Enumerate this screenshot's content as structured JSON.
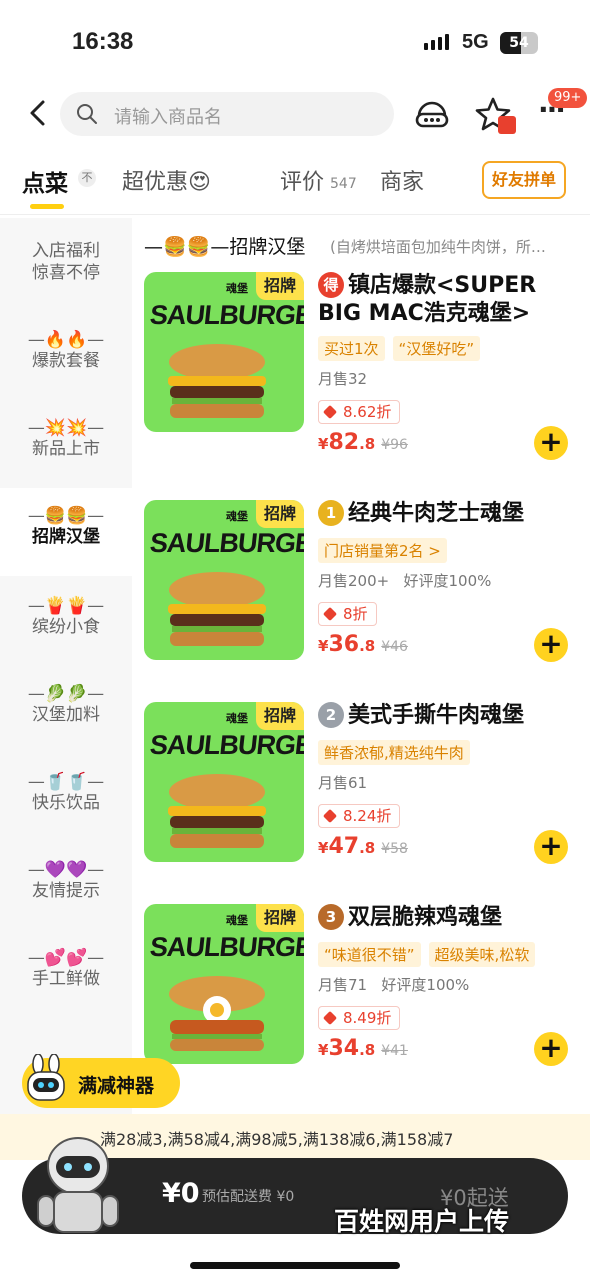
{
  "status_bar": {
    "time": "16:38",
    "network": "5G",
    "battery": "54",
    "battery_level": 0.54
  },
  "header": {
    "search_placeholder": "请输入商品名",
    "more_badge": "99+"
  },
  "tabs": {
    "order": "点菜",
    "order_badge": "不",
    "deals": "超优惠😍",
    "reviews": "评价",
    "reviews_count": "547",
    "merchant": "商家",
    "group_order": "好友拼单"
  },
  "sidebar": {
    "items": [
      {
        "emoji": "",
        "label": "入店福利\n惊喜不停"
      },
      {
        "emoji": "—🔥🔥—",
        "label": "爆款套餐"
      },
      {
        "emoji": "—💥💥—",
        "label": "新品上市"
      },
      {
        "emoji": "—🍔🍔—",
        "label": "招牌汉堡"
      },
      {
        "emoji": "—🍟🍟—",
        "label": "缤纷小食"
      },
      {
        "emoji": "—🥬🥬—",
        "label": "汉堡加料"
      },
      {
        "emoji": "—🥤🥤—",
        "label": "快乐饮品"
      },
      {
        "emoji": "—💜💜—",
        "label": "友情提示"
      },
      {
        "emoji": "—💕💕—",
        "label": "手工鲜做"
      }
    ]
  },
  "section": {
    "title": "—🍔🍔—招牌汉堡",
    "desc": "(自烤烘培面包加纯牛肉饼，所…"
  },
  "products": [
    {
      "brand": "SAULBURGER",
      "top_text": "魂堡",
      "tag": "招牌",
      "rank": "得",
      "name": "镇店爆款<SUPER BIG MAC浩克魂堡>",
      "chips": [
        "买过1次",
        "“汉堡好吃”"
      ],
      "sales": "月售32",
      "rating": "",
      "discount": "8.62折",
      "price_symbol": "¥",
      "price_main": "82",
      "price_dec": ".8",
      "old_price": "¥96"
    },
    {
      "brand": "SAULBURGER",
      "top_text": "魂堡",
      "tag": "招牌",
      "rank": "1",
      "name": "经典牛肉芝士魂堡",
      "chips": [
        "门店销量第2名 >"
      ],
      "sales": "月售200+",
      "rating": "好评度100%",
      "discount": "8折",
      "price_symbol": "¥",
      "price_main": "36",
      "price_dec": ".8",
      "old_price": "¥46"
    },
    {
      "brand": "SAULBURGER",
      "top_text": "魂堡",
      "tag": "招牌",
      "rank": "2",
      "name": "美式手撕牛肉魂堡",
      "chips": [
        "鲜香浓郁,精选纯牛肉"
      ],
      "sales": "月售61",
      "rating": "",
      "discount": "8.24折",
      "price_symbol": "¥",
      "price_main": "47",
      "price_dec": ".8",
      "old_price": "¥58"
    },
    {
      "brand": "SAULBURGER",
      "top_text": "魂堡",
      "tag": "招牌",
      "rank": "3",
      "name": "双层脆辣鸡魂堡",
      "chips": [
        "“味道很不错”",
        "超级美味,松软"
      ],
      "sales": "月售71",
      "rating": "好评度100%",
      "discount": "8.49折",
      "price_symbol": "¥",
      "price_main": "34",
      "price_dec": ".8",
      "old_price": "¥41"
    }
  ],
  "promo": {
    "label": "满减神器"
  },
  "ribbon": {
    "text": "满28减3,满58减4,满98减5,满138减6,满158减7"
  },
  "cart": {
    "total": "¥0",
    "delivery_fee": "预估配送费 ¥0",
    "min_order": "¥0起送"
  },
  "watermark": "百姓网用户上传",
  "colors": {
    "accent": "#ffd21f",
    "price": "#e8402e",
    "thumb_bg": "#7be05b"
  }
}
